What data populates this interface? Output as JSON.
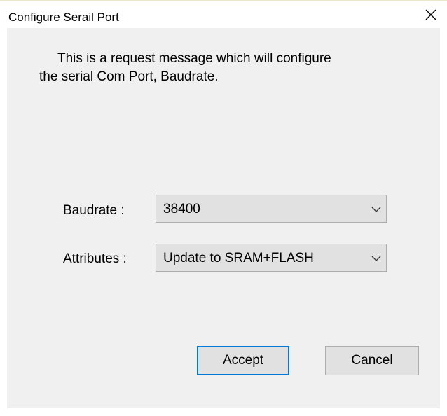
{
  "window": {
    "title": "Configure Serail Port",
    "close_icon": "close-icon"
  },
  "message": {
    "line1": "This is a request message which will configure",
    "line2": "the serial Com Port, Baudrate."
  },
  "baudrate": {
    "label": "Baudrate :",
    "value": "38400",
    "icon": "chevron-down-icon"
  },
  "attributes": {
    "label": "Attributes :",
    "value": "Update to SRAM+FLASH",
    "icon": "chevron-down-icon"
  },
  "buttons": {
    "accept_label": "Accept",
    "cancel_label": "Cancel"
  },
  "colors": {
    "client_background": "#f0f0f0",
    "button_background": "#e1e1e1",
    "default_button_border": "#0078d7",
    "control_border": "#adadad"
  }
}
